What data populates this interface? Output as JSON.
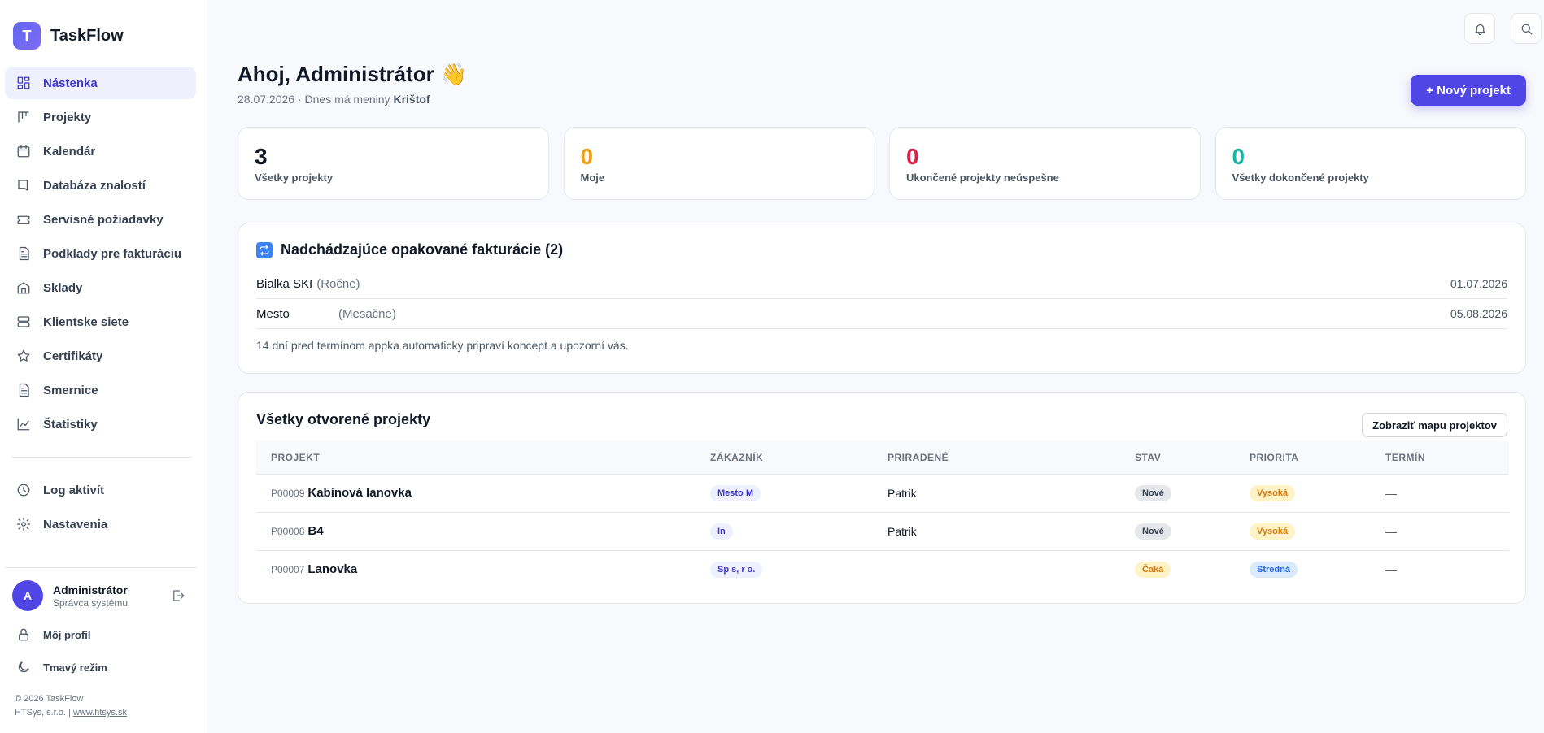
{
  "brand": {
    "logo_letter": "T",
    "name": "TaskFlow"
  },
  "sidebar": {
    "items": [
      {
        "label": "Nástenka",
        "icon": "dashboard-icon"
      },
      {
        "label": "Projekty",
        "icon": "kanban-icon"
      },
      {
        "label": "Kalendár",
        "icon": "calendar-icon"
      },
      {
        "label": "Databáza znalostí",
        "icon": "book-icon"
      },
      {
        "label": "Servisné požiadavky",
        "icon": "ticket-icon"
      },
      {
        "label": "Podklady pre fakturáciu",
        "icon": "document-icon"
      },
      {
        "label": "Sklady",
        "icon": "warehouse-icon"
      },
      {
        "label": "Klientske siete",
        "icon": "server-icon"
      },
      {
        "label": "Certifikáty",
        "icon": "star-icon"
      },
      {
        "label": "Smernice",
        "icon": "document-icon"
      },
      {
        "label": "Štatistiky",
        "icon": "chart-icon"
      }
    ],
    "secondary": [
      {
        "label": "Log aktivít",
        "icon": "clock-icon"
      },
      {
        "label": "Nastavenia",
        "icon": "gear-icon"
      }
    ]
  },
  "user": {
    "avatar_letter": "A",
    "name": "Administrátor",
    "role": "Správca systému",
    "profile_label": "Môj profil",
    "dark_mode_label": "Tmavý režim"
  },
  "footer": {
    "copyright": "© 2026 TaskFlow",
    "company": "HTSys, s.r.o. |",
    "link": "www.htsys.sk"
  },
  "header": {
    "greeting": "Ahoj, Administrátor",
    "emoji": "👋",
    "date": "28.07.2026 · Dnes má meniny",
    "nameday": "Krištof",
    "new_project_label": "+ Nový projekt"
  },
  "stats": [
    {
      "value": "3",
      "label": "Všetky projekty",
      "color": "#111827"
    },
    {
      "value": "0",
      "label": "Moje",
      "color": "#f59e0b"
    },
    {
      "value": "0",
      "label": "Ukončené projekty neúspešne",
      "color": "#e11d48"
    },
    {
      "value": "0",
      "label": "Všetky dokončené projekty",
      "color": "#14b8a6"
    }
  ],
  "billing": {
    "title": "Nadchádzajúce opakované fakturácie (2)",
    "rows": [
      {
        "name": "Bialka SKI",
        "freq": "(Ročne)",
        "date": "01.07.2026"
      },
      {
        "name": "Mesto",
        "freq": "(Mesačne)",
        "date": "05.08.2026"
      }
    ],
    "note": "14 dní pred termínom appka automaticky pripraví koncept a upozorní vás."
  },
  "projects": {
    "title": "Všetky otvorené projekty",
    "map_button": "Zobraziť mapu projektov",
    "columns": [
      "PROJEKT",
      "ZÁKAZNÍK",
      "PRIRADENÉ",
      "STAV",
      "PRIORITA",
      "TERMÍN"
    ],
    "rows": [
      {
        "id": "P00009",
        "name": "Kabínová lanovka",
        "customer": "Mesto M",
        "assigned": "Patrik",
        "status": "Nové",
        "priority": "Vysoká",
        "deadline": "—"
      },
      {
        "id": "P00008",
        "name": "B4",
        "customer": "In",
        "assigned": "Patrik",
        "status": "Nové",
        "priority": "Vysoká",
        "deadline": "—"
      },
      {
        "id": "P00007",
        "name": "Lanovka",
        "customer": "Sp s, r o.",
        "assigned": "",
        "status": "Čaká",
        "priority": "Stredná",
        "deadline": "—"
      }
    ]
  }
}
